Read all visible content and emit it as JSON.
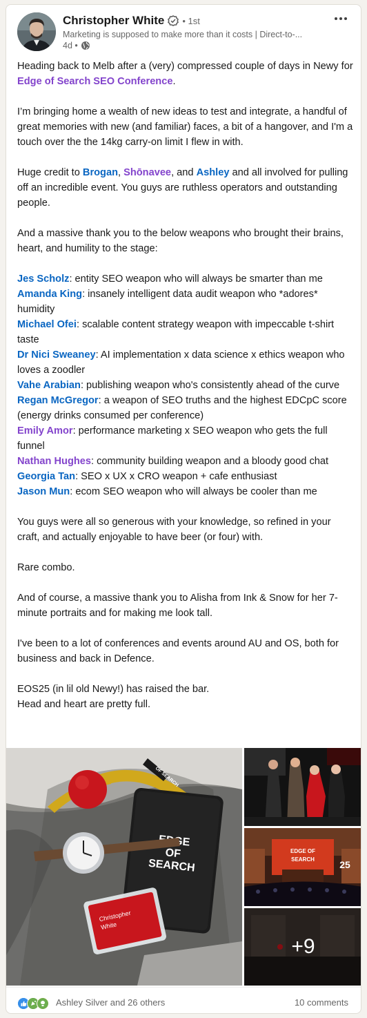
{
  "post": {
    "author": "Christopher White",
    "degree": "• 1st",
    "headline": "Marketing is supposed to make more than it costs | Direct-to-...",
    "time": "4d •",
    "visibility_icon": "globe-icon",
    "menu_icon": "more-icon"
  },
  "body": {
    "p1_a": "Heading back to Melb after a (very) compressed couple of days in Newy for ",
    "p1_link": "Edge of Search SEO Conference",
    "p1_b": ".",
    "p2": "I’m bringing home a wealth of new ideas to test and integrate, a handful of great memories with new (and familiar) faces, a bit of a hangover, and I'm a touch over the the 14kg carry-on limit I flew in with.",
    "p3_a": "Huge credit to ",
    "p3_m1": "Brogan",
    "p3_sep1": ", ",
    "p3_m2": "Shōnavee",
    "p3_sep2": ", and ",
    "p3_m3": "Ashley",
    "p3_b": " and all involved for pulling off an incredible event. You guys are ruthless operators and outstanding people.",
    "p4": "And a massive thank you to the below weapons who brought their brains, heart, and humility to the stage:",
    "speakers": [
      {
        "name": "Jes Scholz",
        "desc": ": entity SEO weapon who will always be smarter than me"
      },
      {
        "name": "Amanda King",
        "desc": ": insanely intelligent data audit weapon who *adores* humidity"
      },
      {
        "name": "Michael Ofei",
        "desc": ": scalable content strategy weapon with impeccable t-shirt taste"
      },
      {
        "name": "Dr Nici Sweaney",
        "desc": ": AI implementation x data science x ethics weapon who loves a zoodler"
      },
      {
        "name": "Vahe Arabian",
        "desc": ": publishing weapon who's consistently ahead of the curve"
      },
      {
        "name": "Regan McGregor",
        "desc": ": a weapon of SEO truths and the highest EDCpC score (energy drinks consumed per conference)"
      },
      {
        "name": "Emily Amor",
        "desc": ": performance marketing x SEO weapon who gets the full funnel"
      },
      {
        "name": "Nathan Hughes",
        "desc": ": community building weapon and a bloody good chat"
      },
      {
        "name": "Georgia Tan",
        "desc": ": SEO x UX x CRO weapon + cafe enthusiast"
      },
      {
        "name": "Jason Mun",
        "desc": ": ecom SEO weapon who will always be cooler than me"
      }
    ],
    "p5": "You guys were all so generous with your knowledge, so refined in your craft, and actually enjoyable to have beer (or four) with.",
    "p6": "Rare combo.",
    "p7": "And of course, a massive thank you to Alisha from Ink & Snow for her 7-minute portraits and for making me look tall.",
    "p8": "I've been to a lot of conferences and events around AU and OS, both for business and back in Defence.",
    "p9": "EOS25 (in lil old Newy!) has raised the bar.",
    "p10": "Head and heart are pretty full."
  },
  "media": {
    "notebook_line1": "EDGE",
    "notebook_line2": "OF",
    "notebook_line3": "SEARCH",
    "badge_name1": "Christopher",
    "badge_name2": "White",
    "strap_text": "OF SEARCH",
    "screen_line1": "EDGE OF",
    "screen_line2": "SEARCH",
    "stage_number": "25",
    "more_photos": "+9"
  },
  "social": {
    "reactions_text": "Ashley Silver and 26 others",
    "comments_text": "10 comments",
    "reaction_icons": [
      "like-icon",
      "celebrate-icon",
      "insightful-icon"
    ]
  },
  "colors": {
    "link_blue": "#0a66c2",
    "link_purple": "#8344cc"
  }
}
